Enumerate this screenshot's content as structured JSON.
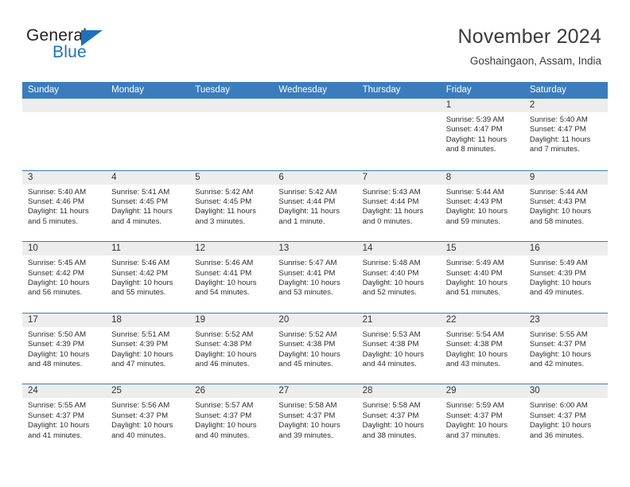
{
  "brand": {
    "name_part1": "General",
    "name_part2": "Blue",
    "accent_color": "#1e72bc"
  },
  "header": {
    "title": "November 2024",
    "subtitle": "Goshaingaon, Assam, India",
    "header_bg_color": "#3b7cbd",
    "daynum_band_color": "#ededed"
  },
  "calendar": {
    "weekday_headers": [
      "Sunday",
      "Monday",
      "Tuesday",
      "Wednesday",
      "Thursday",
      "Friday",
      "Saturday"
    ],
    "labels": {
      "sunrise": "Sunrise:",
      "sunset": "Sunset:",
      "daylight": "Daylight:"
    },
    "weeks": [
      [
        {
          "day": "",
          "empty": true
        },
        {
          "day": "",
          "empty": true
        },
        {
          "day": "",
          "empty": true
        },
        {
          "day": "",
          "empty": true
        },
        {
          "day": "",
          "empty": true
        },
        {
          "day": "1",
          "sunrise": "Sunrise: 5:39 AM",
          "sunset": "Sunset: 4:47 PM",
          "daylight1": "Daylight: 11 hours",
          "daylight2": "and 8 minutes."
        },
        {
          "day": "2",
          "sunrise": "Sunrise: 5:40 AM",
          "sunset": "Sunset: 4:47 PM",
          "daylight1": "Daylight: 11 hours",
          "daylight2": "and 7 minutes."
        }
      ],
      [
        {
          "day": "3",
          "sunrise": "Sunrise: 5:40 AM",
          "sunset": "Sunset: 4:46 PM",
          "daylight1": "Daylight: 11 hours",
          "daylight2": "and 5 minutes."
        },
        {
          "day": "4",
          "sunrise": "Sunrise: 5:41 AM",
          "sunset": "Sunset: 4:45 PM",
          "daylight1": "Daylight: 11 hours",
          "daylight2": "and 4 minutes."
        },
        {
          "day": "5",
          "sunrise": "Sunrise: 5:42 AM",
          "sunset": "Sunset: 4:45 PM",
          "daylight1": "Daylight: 11 hours",
          "daylight2": "and 3 minutes."
        },
        {
          "day": "6",
          "sunrise": "Sunrise: 5:42 AM",
          "sunset": "Sunset: 4:44 PM",
          "daylight1": "Daylight: 11 hours",
          "daylight2": "and 1 minute."
        },
        {
          "day": "7",
          "sunrise": "Sunrise: 5:43 AM",
          "sunset": "Sunset: 4:44 PM",
          "daylight1": "Daylight: 11 hours",
          "daylight2": "and 0 minutes."
        },
        {
          "day": "8",
          "sunrise": "Sunrise: 5:44 AM",
          "sunset": "Sunset: 4:43 PM",
          "daylight1": "Daylight: 10 hours",
          "daylight2": "and 59 minutes."
        },
        {
          "day": "9",
          "sunrise": "Sunrise: 5:44 AM",
          "sunset": "Sunset: 4:43 PM",
          "daylight1": "Daylight: 10 hours",
          "daylight2": "and 58 minutes."
        }
      ],
      [
        {
          "day": "10",
          "sunrise": "Sunrise: 5:45 AM",
          "sunset": "Sunset: 4:42 PM",
          "daylight1": "Daylight: 10 hours",
          "daylight2": "and 56 minutes."
        },
        {
          "day": "11",
          "sunrise": "Sunrise: 5:46 AM",
          "sunset": "Sunset: 4:42 PM",
          "daylight1": "Daylight: 10 hours",
          "daylight2": "and 55 minutes."
        },
        {
          "day": "12",
          "sunrise": "Sunrise: 5:46 AM",
          "sunset": "Sunset: 4:41 PM",
          "daylight1": "Daylight: 10 hours",
          "daylight2": "and 54 minutes."
        },
        {
          "day": "13",
          "sunrise": "Sunrise: 5:47 AM",
          "sunset": "Sunset: 4:41 PM",
          "daylight1": "Daylight: 10 hours",
          "daylight2": "and 53 minutes."
        },
        {
          "day": "14",
          "sunrise": "Sunrise: 5:48 AM",
          "sunset": "Sunset: 4:40 PM",
          "daylight1": "Daylight: 10 hours",
          "daylight2": "and 52 minutes."
        },
        {
          "day": "15",
          "sunrise": "Sunrise: 5:49 AM",
          "sunset": "Sunset: 4:40 PM",
          "daylight1": "Daylight: 10 hours",
          "daylight2": "and 51 minutes."
        },
        {
          "day": "16",
          "sunrise": "Sunrise: 5:49 AM",
          "sunset": "Sunset: 4:39 PM",
          "daylight1": "Daylight: 10 hours",
          "daylight2": "and 49 minutes."
        }
      ],
      [
        {
          "day": "17",
          "sunrise": "Sunrise: 5:50 AM",
          "sunset": "Sunset: 4:39 PM",
          "daylight1": "Daylight: 10 hours",
          "daylight2": "and 48 minutes."
        },
        {
          "day": "18",
          "sunrise": "Sunrise: 5:51 AM",
          "sunset": "Sunset: 4:39 PM",
          "daylight1": "Daylight: 10 hours",
          "daylight2": "and 47 minutes."
        },
        {
          "day": "19",
          "sunrise": "Sunrise: 5:52 AM",
          "sunset": "Sunset: 4:38 PM",
          "daylight1": "Daylight: 10 hours",
          "daylight2": "and 46 minutes."
        },
        {
          "day": "20",
          "sunrise": "Sunrise: 5:52 AM",
          "sunset": "Sunset: 4:38 PM",
          "daylight1": "Daylight: 10 hours",
          "daylight2": "and 45 minutes."
        },
        {
          "day": "21",
          "sunrise": "Sunrise: 5:53 AM",
          "sunset": "Sunset: 4:38 PM",
          "daylight1": "Daylight: 10 hours",
          "daylight2": "and 44 minutes."
        },
        {
          "day": "22",
          "sunrise": "Sunrise: 5:54 AM",
          "sunset": "Sunset: 4:38 PM",
          "daylight1": "Daylight: 10 hours",
          "daylight2": "and 43 minutes."
        },
        {
          "day": "23",
          "sunrise": "Sunrise: 5:55 AM",
          "sunset": "Sunset: 4:37 PM",
          "daylight1": "Daylight: 10 hours",
          "daylight2": "and 42 minutes."
        }
      ],
      [
        {
          "day": "24",
          "sunrise": "Sunrise: 5:55 AM",
          "sunset": "Sunset: 4:37 PM",
          "daylight1": "Daylight: 10 hours",
          "daylight2": "and 41 minutes."
        },
        {
          "day": "25",
          "sunrise": "Sunrise: 5:56 AM",
          "sunset": "Sunset: 4:37 PM",
          "daylight1": "Daylight: 10 hours",
          "daylight2": "and 40 minutes."
        },
        {
          "day": "26",
          "sunrise": "Sunrise: 5:57 AM",
          "sunset": "Sunset: 4:37 PM",
          "daylight1": "Daylight: 10 hours",
          "daylight2": "and 40 minutes."
        },
        {
          "day": "27",
          "sunrise": "Sunrise: 5:58 AM",
          "sunset": "Sunset: 4:37 PM",
          "daylight1": "Daylight: 10 hours",
          "daylight2": "and 39 minutes."
        },
        {
          "day": "28",
          "sunrise": "Sunrise: 5:58 AM",
          "sunset": "Sunset: 4:37 PM",
          "daylight1": "Daylight: 10 hours",
          "daylight2": "and 38 minutes."
        },
        {
          "day": "29",
          "sunrise": "Sunrise: 5:59 AM",
          "sunset": "Sunset: 4:37 PM",
          "daylight1": "Daylight: 10 hours",
          "daylight2": "and 37 minutes."
        },
        {
          "day": "30",
          "sunrise": "Sunrise: 6:00 AM",
          "sunset": "Sunset: 4:37 PM",
          "daylight1": "Daylight: 10 hours",
          "daylight2": "and 36 minutes."
        }
      ]
    ]
  }
}
